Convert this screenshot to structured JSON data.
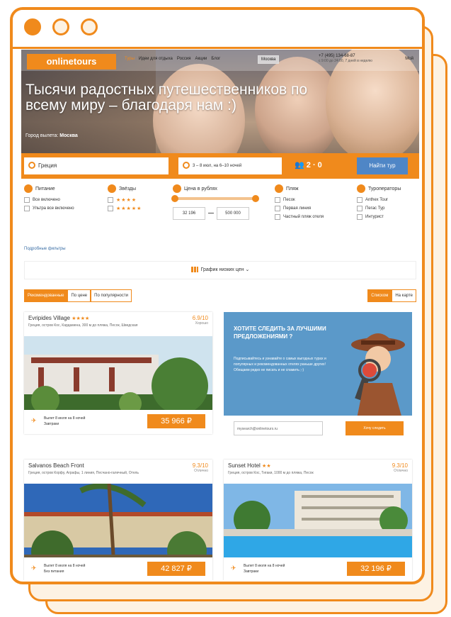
{
  "window": {
    "controls": [
      "close",
      "minimize",
      "maximize"
    ]
  },
  "nav": {
    "logo": "onlinetours",
    "links": [
      "Туры",
      "Идеи для отдыха",
      "Россия",
      "Акции",
      "Блог"
    ],
    "city": "Москва",
    "phone": "+7 (495) 134-68-87",
    "hours": "с 9:00 до 24:00, 7 дней в неделю",
    "account": "Мой"
  },
  "hero": {
    "headline": "Тысячи радостных путешественников по всему миру – благодаря нам :)",
    "departure_label": "Город вылета:",
    "departure_city": "Москва"
  },
  "search": {
    "country": "Греция",
    "dates": "3 – 8 июл, на 6–10 ночей",
    "tourists": "2 · 0",
    "button": "Найти тур"
  },
  "filters": {
    "meal": {
      "title": "Питание",
      "options": [
        "Все включено",
        "Ультра все включено"
      ]
    },
    "stars": {
      "title": "Звёзды",
      "options": [
        "★★★★",
        "★★★★★"
      ]
    },
    "price": {
      "title": "Цена в рублях",
      "min": "32 196",
      "max": "500 000"
    },
    "beach": {
      "title": "Пляж",
      "options": [
        "Песок",
        "Первая линия",
        "Частный пляж отеля"
      ]
    },
    "operators": {
      "title": "Туроператоры",
      "options": [
        "Anthex Tour",
        "Пегас Тур",
        "Интурист"
      ]
    },
    "more": "Подробные фильтры"
  },
  "price_chart": {
    "label": "График низких цен"
  },
  "sort": {
    "tabs": [
      "Рекомендованные",
      "По цене",
      "По популярности"
    ],
    "active": "Рекомендованные",
    "view_tabs": [
      "Списком",
      "На карте"
    ],
    "active_view": "Списком"
  },
  "hotels": [
    {
      "name": "Evripides Village",
      "stars": "★★★★",
      "location": "Греция, остров Кос, Кардамена, 300 м до пляжа, Песок, Шведская",
      "rating": "6.9/10",
      "rating_label": "Хорошо",
      "departure": "Вылет 8 июля на 8 ночей",
      "meal": "Завтраки",
      "price": "35 966"
    },
    {
      "name": "Salvanos Beach Front",
      "stars": "",
      "location": "Греция, остров Корфу, Аграфы, 1 линия, Песчано-галечный, Отель",
      "rating": "9.3/10",
      "rating_label": "Отлично",
      "departure": "Вылет 8 июля на 8 ночей",
      "meal": "Без питания",
      "price": "42 827"
    },
    {
      "name": "Sunset Hotel",
      "stars": "★★",
      "location": "Греция, остров Кос, Тигаки, 1000 м до пляжа, Песок",
      "rating": "9.3/10",
      "rating_label": "Отлично",
      "departure": "Вылет 8 июля на 8 ночей",
      "meal": "Завтраки",
      "price": "32 196"
    }
  ],
  "promo": {
    "title": "ХОТИТЕ СЛЕДИТЬ ЗА ЛУЧШИМИ ПРЕДЛОЖЕНИЯМИ ?",
    "text": "Подписывайтесь и узнавайте о самых выгодных турах и популярных и рекомендованных отелях раньше других! Обещаем редко не писать и не спамить ;-)",
    "email_placeholder": "mysearch@onlinetours.ru",
    "button": "Хочу следить"
  },
  "colors": {
    "accent": "#f08a1c",
    "promo": "#5b99c9",
    "search_button": "#4f86c6"
  }
}
